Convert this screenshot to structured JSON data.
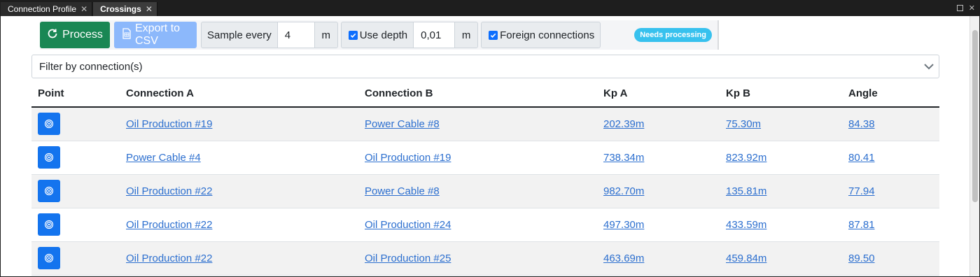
{
  "tabs": [
    {
      "label": "Connection Profile",
      "active": false
    },
    {
      "label": "Crossings",
      "active": true
    }
  ],
  "window": {
    "close_glyph": "✕",
    "tab_close_glyph": "✕"
  },
  "toolbar": {
    "process_label": "Process",
    "export_label": "Export to CSV",
    "sample_label": "Sample every",
    "sample_value": "4",
    "sample_unit": "m",
    "use_depth_label": "Use depth",
    "use_depth_checked": true,
    "depth_value": "0,01",
    "depth_unit": "m",
    "foreign_label": "Foreign connections",
    "foreign_checked": true,
    "status_badge": "Needs processing"
  },
  "filter": {
    "placeholder": "Filter by connection(s)"
  },
  "table": {
    "headers": {
      "point": "Point",
      "conn_a": "Connection A",
      "conn_b": "Connection B",
      "kp_a": "Kp A",
      "kp_b": "Kp B",
      "angle": "Angle"
    },
    "rows": [
      {
        "conn_a": "Oil Production #19",
        "conn_b": "Power Cable #8",
        "kp_a": "202.39m",
        "kp_b": "75.30m",
        "angle": "84.38"
      },
      {
        "conn_a": "Power Cable #4",
        "conn_b": "Oil Production #19",
        "kp_a": "738.34m",
        "kp_b": "823.92m",
        "angle": "80.41"
      },
      {
        "conn_a": "Oil Production #22",
        "conn_b": "Power Cable #8",
        "kp_a": "982.70m",
        "kp_b": "135.81m",
        "angle": "77.94"
      },
      {
        "conn_a": "Oil Production #22",
        "conn_b": "Oil Production #24",
        "kp_a": "497.30m",
        "kp_b": "433.59m",
        "angle": "87.81"
      },
      {
        "conn_a": "Oil Production #22",
        "conn_b": "Oil Production #25",
        "kp_a": "463.69m",
        "kp_b": "459.84m",
        "angle": "89.50"
      }
    ]
  },
  "colors": {
    "process_button": "#198754",
    "export_button": "#8cb8fb",
    "checkbox": "#0d6efd",
    "badge": "#37c1ee",
    "point_button": "#1474ee",
    "link": "#2c6fcf"
  }
}
